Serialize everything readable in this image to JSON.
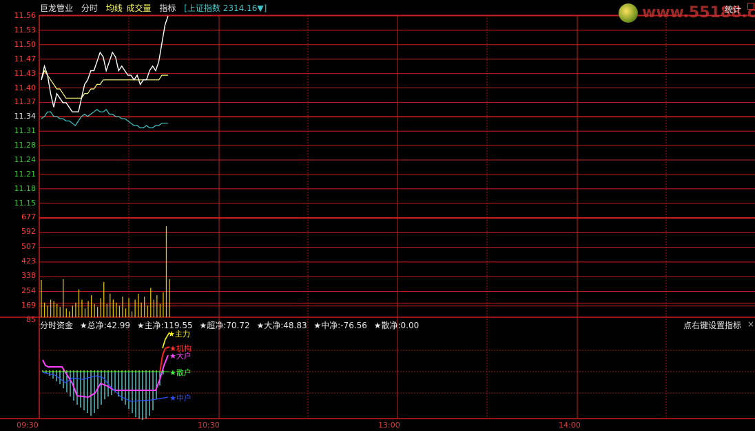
{
  "header": {
    "stock_name": "巨龙管业",
    "tab_fenshi": "分时",
    "tab_junxian": "均线",
    "tab_chengjiaoliang": "成交量",
    "tab_zhibiao": "指标",
    "index_label": "[上证指数 2314.16▼]"
  },
  "logo": {
    "text": "www.55188.com"
  },
  "stats_button": "统计",
  "price_axis": [
    "11.56",
    "11.53",
    "11.50",
    "11.47",
    "11.43",
    "11.40",
    "11.37",
    "11.34",
    "11.31",
    "11.28",
    "11.24",
    "11.21",
    "11.18",
    "11.15"
  ],
  "volume_axis": [
    "677",
    "592",
    "507",
    "423",
    "338",
    "254",
    "169",
    "85"
  ],
  "time_axis": [
    "09:30",
    "10:30",
    "13:00",
    "14:00"
  ],
  "capital_flow": {
    "title": "分时资金",
    "total": "★总净:42.99",
    "main": "★主净:119.55",
    "super": "★超净:70.72",
    "large": "★大净:48.83",
    "medium": "★中净:-76.56",
    "retail": "★散净:0.00",
    "tip": "点右键设置指标",
    "close": "×",
    "labels": {
      "zhuli": "★主力",
      "jigou": "★机构",
      "dahu": "★大户",
      "sanhu": "★散户",
      "zhonghu": "★中户"
    }
  },
  "colors": {
    "grid": "#c81e1e",
    "price_up": "#ff3c3c",
    "price_down": "#38c838",
    "price_line": "#ffffff",
    "avg_line": "#ffff80",
    "index_line": "#3fc7c7",
    "volume": "#e0c000",
    "zhuli": "#ffff00",
    "jigou": "#ff2020",
    "dahu": "#ff40ff",
    "sanhu": "#40ff40",
    "zhonghu": "#3050ff",
    "bars_cyan": "#60f0f0"
  },
  "chart_data": {
    "type": "line",
    "title": "",
    "ylim": [
      11.15,
      11.56
    ],
    "price": [
      11.42,
      11.45,
      11.43,
      11.39,
      11.36,
      11.39,
      11.38,
      11.37,
      11.37,
      11.36,
      11.35,
      11.35,
      11.35,
      11.38,
      11.41,
      11.42,
      11.44,
      11.44,
      11.46,
      11.48,
      11.47,
      11.44,
      11.46,
      11.48,
      11.47,
      11.44,
      11.45,
      11.44,
      11.43,
      11.43,
      11.42,
      11.43,
      11.41,
      11.42,
      11.42,
      11.44,
      11.45,
      11.44,
      11.46,
      11.5,
      11.54,
      11.56
    ],
    "avg": [
      11.42,
      11.44,
      11.43,
      11.42,
      11.41,
      11.4,
      11.4,
      11.39,
      11.38,
      11.38,
      11.38,
      11.38,
      11.38,
      11.38,
      11.39,
      11.39,
      11.4,
      11.4,
      11.41,
      11.41,
      11.42,
      11.42,
      11.42,
      11.42,
      11.42,
      11.42,
      11.42,
      11.42,
      11.42,
      11.42,
      11.42,
      11.42,
      11.42,
      11.42,
      11.42,
      11.42,
      11.42,
      11.42,
      11.42,
      11.43,
      11.43,
      11.43
    ],
    "index": [
      11.335,
      11.34,
      11.35,
      11.35,
      11.34,
      11.34,
      11.335,
      11.335,
      11.33,
      11.33,
      11.325,
      11.32,
      11.33,
      11.34,
      11.345,
      11.34,
      11.345,
      11.35,
      11.355,
      11.35,
      11.35,
      11.355,
      11.345,
      11.345,
      11.34,
      11.34,
      11.335,
      11.335,
      11.33,
      11.325,
      11.32,
      11.32,
      11.315,
      11.315,
      11.32,
      11.315,
      11.315,
      11.32,
      11.32,
      11.325,
      11.325,
      11.325
    ],
    "volume": [
      254,
      100,
      80,
      120,
      110,
      90,
      70,
      260,
      60,
      40,
      80,
      100,
      190,
      120,
      60,
      110,
      150,
      90,
      70,
      130,
      240,
      90,
      160,
      120,
      100,
      80,
      140,
      60,
      130,
      40,
      120,
      160,
      100,
      140,
      80,
      200,
      120,
      150,
      90,
      170,
      620,
      260
    ]
  }
}
